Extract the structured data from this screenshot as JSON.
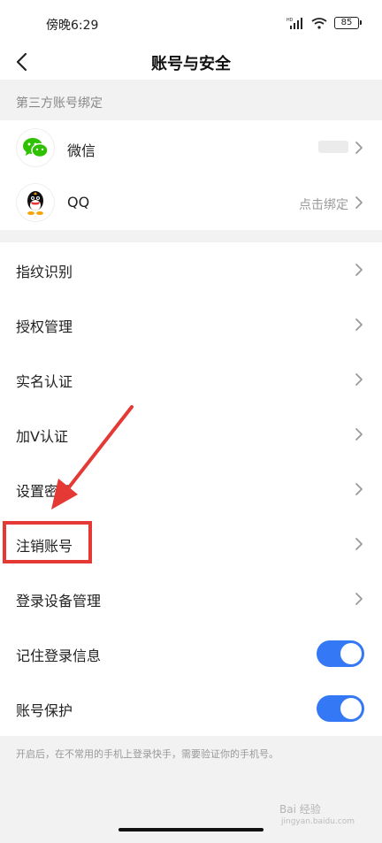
{
  "status_bar": {
    "time": "傍晚6:29",
    "battery": "85",
    "network": "HD"
  },
  "nav": {
    "title": "账号与安全"
  },
  "third_party": {
    "section_label": "第三方账号绑定",
    "items": [
      {
        "label": "微信",
        "value": "",
        "icon": "wechat-icon"
      },
      {
        "label": "QQ",
        "value": "点击绑定",
        "icon": "qq-icon"
      }
    ]
  },
  "settings": {
    "items": [
      {
        "label": "指纹识别",
        "type": "link"
      },
      {
        "label": "授权管理",
        "type": "link"
      },
      {
        "label": "实名认证",
        "type": "link"
      },
      {
        "label": "加V认证",
        "type": "link"
      },
      {
        "label": "设置密码",
        "type": "link"
      },
      {
        "label": "注销账号",
        "type": "link"
      },
      {
        "label": "登录设备管理",
        "type": "link"
      },
      {
        "label": "记住登录信息",
        "type": "toggle",
        "on": true
      },
      {
        "label": "账号保护",
        "type": "toggle",
        "on": true
      }
    ]
  },
  "footer": {
    "note": "开启后，在不常用的手机上登录快手，需要验证你的手机号。"
  },
  "watermark": {
    "text": "Bai 经验",
    "sub": "jingyan.baidu.com"
  },
  "colors": {
    "accent": "#3478f6",
    "annotation": "#e53935",
    "background": "#f2f2f2"
  }
}
